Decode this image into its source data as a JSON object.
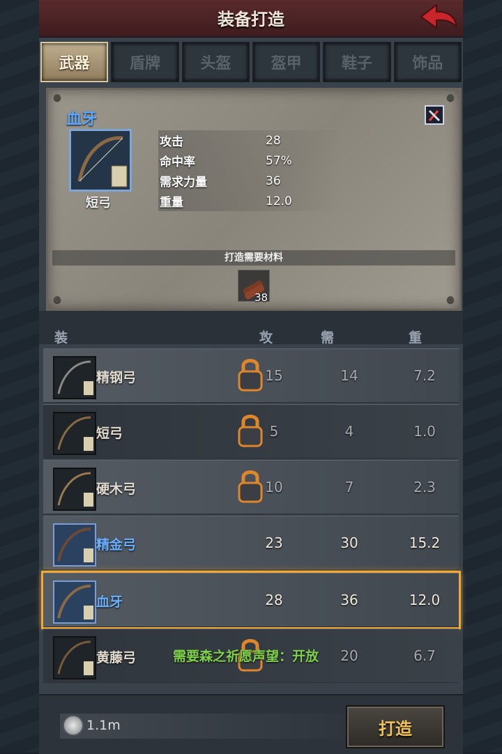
{
  "header": {
    "title": "装备打造",
    "back_icon": "back-arrow-icon"
  },
  "tabs": [
    {
      "label": "武器",
      "active": true
    },
    {
      "label": "盾牌",
      "active": false
    },
    {
      "label": "头盔",
      "active": false
    },
    {
      "label": "盔甲",
      "active": false
    },
    {
      "label": "鞋子",
      "active": false
    },
    {
      "label": "饰品",
      "active": false
    }
  ],
  "detail": {
    "name": "血牙",
    "type": "短弓",
    "stats": [
      {
        "label": "攻击",
        "value": "28"
      },
      {
        "label": "命中率",
        "value": "57%"
      },
      {
        "label": "需求力量",
        "value": "36"
      },
      {
        "label": "重量",
        "value": "12.0"
      }
    ],
    "materials_title": "打造需要材料",
    "material_count": "38",
    "material_icon": "wood-log-icon"
  },
  "list_header": {
    "filter": "装备筛选",
    "attack": "攻击",
    "str_req": "需求力量",
    "weight": "重量",
    "sort_arrow": "▲"
  },
  "items": [
    {
      "name": "精钢弓",
      "attack": "15",
      "str": "14",
      "weight": "7.2",
      "locked": true
    },
    {
      "name": "短弓",
      "attack": "5",
      "str": "4",
      "weight": "1.0",
      "locked": true
    },
    {
      "name": "硬木弓",
      "attack": "10",
      "str": "7",
      "weight": "2.3",
      "locked": true
    },
    {
      "name": "精金弓",
      "attack": "23",
      "str": "30",
      "weight": "15.2",
      "locked": false
    },
    {
      "name": "血牙",
      "attack": "28",
      "str": "36",
      "weight": "12.0",
      "locked": false,
      "selected": true
    },
    {
      "name": "黄藤弓",
      "attack": "",
      "str": "20",
      "weight": "6.7",
      "locked": true,
      "requirement": "需要森之祈愿声望：开放"
    }
  ],
  "footer": {
    "currency": "1.1m",
    "craft_label": "打造"
  },
  "colors": {
    "accent_selected": "#f3a833",
    "name_blue": "#5aa8ff",
    "requirement_green": "#7fd24a"
  }
}
